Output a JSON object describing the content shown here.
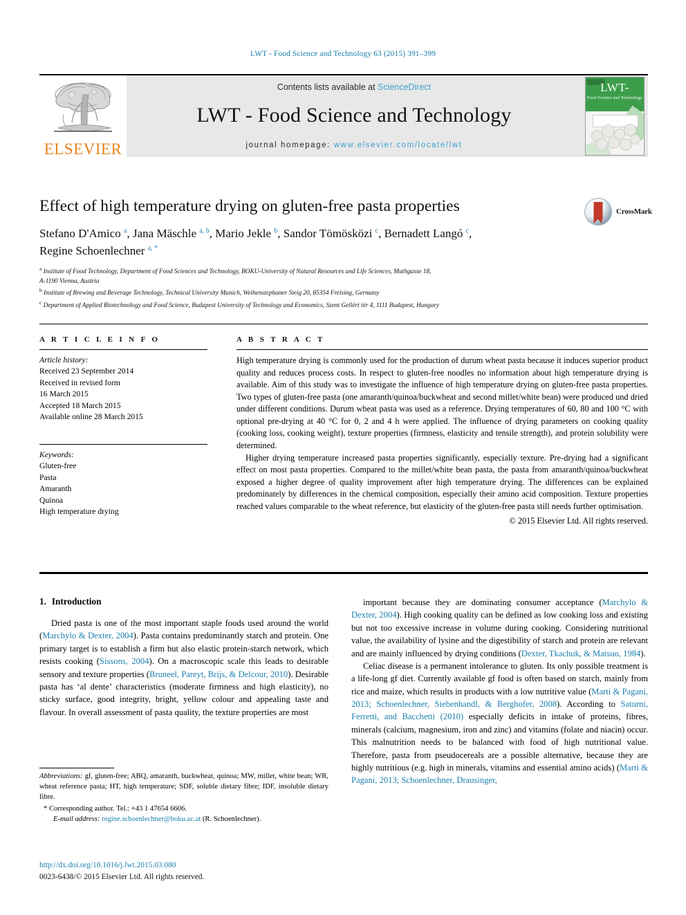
{
  "running_head": "LWT - Food Science and Technology 63 (2015) 391–399",
  "masthead": {
    "publisher_logo_text": "ELSEVIER",
    "contents_prefix": "Contents lists available at ",
    "contents_link": "ScienceDirect",
    "journal_name": "LWT - Food Science and Technology",
    "homepage_prefix": "journal homepage: ",
    "homepage_url": "www.elsevier.com/locate/lwt",
    "cover": {
      "title": "LWT-",
      "subtitle": "Food Science and Technology"
    }
  },
  "article": {
    "title": "Effect of high temperature drying on gluten-free pasta properties",
    "crossmark_label": "CrossMark",
    "authors_line_1": "Stefano D'Amico <sup>a</sup>, Jana Mäschle <sup>a, b</sup>, Mario Jekle <sup>b</sup>, Sandor Tömösközi <sup>c</sup>, Bernadett Langó <sup>c</sup>,",
    "authors_line_2": "Regine Schoenlechner <sup>a, *</sup>",
    "affiliations": [
      "<sup>a</sup> Institute of Food Technology, Department of Food Sciences and Technology, BOKU-University of Natural Resources and Life Sciences, Muthgasse 18,",
      "A-1190 Vienna, Austria",
      "<sup>b</sup> Institute of Brewing and Beverage Technology, Technical University Munich, Weihenstephaner Steig 20, 85354 Freising, Germany",
      "<sup>c</sup> Department of Applied Biotechnology and Food Science, Budapest University of Technology and Economics, Szent Gellért tér 4, 1111 Budapest, Hungary"
    ]
  },
  "article_info": {
    "heading": "A R T I C L E   I N F O",
    "history_label": "Article history:",
    "history_lines": [
      "Received 23 September 2014",
      "Received in revised form",
      "16 March 2015",
      "Accepted 18 March 2015",
      "Available online 28 March 2015"
    ],
    "keywords_label": "Keywords:",
    "keywords": [
      "Gluten-free",
      "Pasta",
      "Amaranth",
      "Quinoa",
      "High temperature drying"
    ]
  },
  "abstract": {
    "heading": "A B S T R A C T",
    "paragraph_1": "High temperature drying is commonly used for the production of durum wheat pasta because it induces superior product quality and reduces process costs. In respect to gluten-free noodles no information about high temperature drying is available. Aim of this study was to investigate the influence of high temperature drying on gluten-free pasta properties. Two types of gluten-free pasta (one amaranth/quinoa/buckwheat and second millet/white bean) were produced und dried under different conditions. Durum wheat pasta was used as a reference. Drying temperatures of 60, 80 and 100 °C with optional pre-drying at 40 °C for 0, 2 and 4 h were applied. The influence of drying parameters on cooking quality (cooking loss, cooking weight), texture properties (firmness, elasticity and tensile strength), and protein solubility were determined.",
    "paragraph_2": "Higher drying temperature increased pasta properties significantly, especially texture. Pre-drying had a significant effect on most pasta properties. Compared to the millet/white bean pasta, the pasta from amaranth/quinoa/buckwheat exposed a higher degree of quality improvement after high temperature drying. The differences can be explained predominately by differences in the chemical composition, especially their amino acid composition. Texture properties reached values comparable to the wheat reference, but elasticity of the gluten-free pasta still needs further optimisation.",
    "copyright": "© 2015 Elsevier Ltd. All rights reserved."
  },
  "introduction": {
    "number": "1.",
    "heading": "Introduction",
    "left_paragraph": "Dried pasta is one of the most important staple foods used around the world (<span class=\"ref\">Marchylo &amp; Dexter, 2004</span>). Pasta contains predominantly starch and protein. One primary target is to establish a firm but also elastic protein-starch network, which resists cooking (<span class=\"ref\">Sissons, 2004</span>). On a macroscopic scale this leads to desirable sensory and texture properties (<span class=\"ref\">Bruneel, Pareyt, Brijs, &amp; Delcour, 2010</span>). Desirable pasta has ‘al dente’ characteristics (moderate firmness and high elasticity), no sticky surface, good integrity, bright, yellow colour and appealing taste and flavour. In overall assessment of pasta quality, the texture properties are most",
    "right_paragraph_1": "important because they are dominating consumer acceptance (<span class=\"ref\">Marchylo &amp; Dexter, 2004</span>). High cooking quality can be defined as low cooking loss and existing but not too excessive increase in volume during cooking. Considering nutritional value, the availability of lysine and the digestibility of starch and protein are relevant and are mainly influenced by drying conditions (<span class=\"ref\">Dexter, Tkachuk, &amp; Matsuo, 1984</span>).",
    "right_paragraph_2": "Celiac disease is a permanent intolerance to gluten. Its only possible treatment is a life-long gf diet. Currently available gf food is often based on starch, mainly from rice and maize, which results in products with a low nutritive value (<span class=\"ref\">Marti &amp; Pagani, 2013; Schoenlechner, Siebenhandl, &amp; Berghofer, 2008</span>). According to <span class=\"ref\">Saturni, Ferretti, and Bacchetti (2010)</span> especially deficits in intake of proteins, fibres, minerals (calcium, magnesium, iron and zinc) and vitamins (folate and niacin) occur. This malnutrition needs to be balanced with food of high nutritional value. Therefore, pasta from pseudocereals are a possible alternative, because they are highly nutritious (e.g. high in minerals, vitamins and essential amino acids) (<span class=\"ref\">Marti &amp; Pagani, 2013; Schoenlechner, Drausinger,</span>"
  },
  "footnotes": {
    "abbreviations": "<span class=\"it\">Abbreviations:</span> gf, gluten-free; ABQ, amaranth, buckwheat, quinoa; MW, millet, white bean; WR, wheat reference pasta; HT, high temperature; SDF, soluble dietary fibre; IDF, insoluble dietary fibre.",
    "corresponding": "* Corresponding author. Tel.: +43 1 47654 6606.",
    "email_label": "E-mail address:",
    "email": "regine.schoenlechner@boku.ac.at",
    "email_suffix": "(R. Schoenlechner).",
    "doi": "http://dx.doi.org/10.1016/j.lwt.2015.03.080",
    "issn": "0023-6438/© 2015 Elsevier Ltd. All rights reserved."
  },
  "colors": {
    "link_blue": "#1a7fad",
    "sciencedirect_blue": "#3fa0d0",
    "elsevier_orange": "#e8821e",
    "cover_green": "#3c9e4b",
    "crossmark_red": "#c0392b"
  }
}
